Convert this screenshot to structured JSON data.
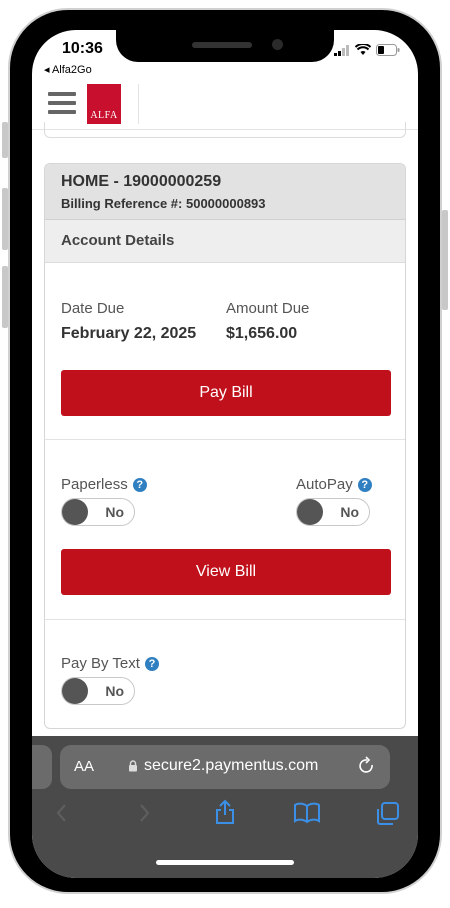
{
  "status_bar": {
    "time": "10:36",
    "back_app": "◂ Alfa2Go"
  },
  "header": {
    "logo_text": "ALFA"
  },
  "account_card": {
    "title": "HOME - 19000000259",
    "billing_reference": "Billing Reference #: 50000000893",
    "section_title": "Account Details",
    "date_due_label": "Date Due",
    "date_due_value": "February 22, 2025",
    "amount_due_label": "Amount Due",
    "amount_due_value": "$1,656.00",
    "pay_bill_label": "Pay Bill",
    "paperless_label": "Paperless",
    "paperless_state": "No",
    "autopay_label": "AutoPay",
    "autopay_state": "No",
    "view_bill_label": "View Bill",
    "pay_by_text_label": "Pay By Text",
    "pay_by_text_state": "No"
  },
  "browser": {
    "aa_label": "AA",
    "url": "secure2.paymentus.com"
  },
  "colors": {
    "brand_red": "#c0101b",
    "help_blue": "#2f7fc1"
  },
  "icons": [
    "hamburger-menu-icon",
    "help-icon",
    "lock-icon",
    "reload-icon",
    "back-icon",
    "forward-icon",
    "share-icon",
    "bookmarks-icon",
    "tabs-icon"
  ]
}
